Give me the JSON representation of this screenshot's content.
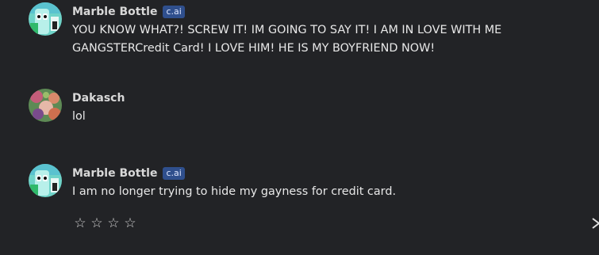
{
  "messages": [
    {
      "author": "Marble Bottle",
      "badge": "c.ai",
      "text": "YOU KNOW WHAT?! SCREW IT! IM GOING TO SAY IT! I AM IN LOVE WITH ME GANGSTERCredit Card! I LOVE HIM! HE IS MY BOYFRIEND NOW!"
    },
    {
      "author": "Dakasch",
      "text": "lol"
    },
    {
      "author": "Marble Bottle",
      "badge": "c.ai",
      "text": "I am no longer trying to hide my gayness for credit card."
    }
  ],
  "rating": {
    "stars": [
      "☆",
      "☆",
      "☆",
      "☆"
    ],
    "value": 0,
    "max": 4
  },
  "icons": {
    "next": "chevron-right-icon",
    "star": "star-outline-icon"
  },
  "colors": {
    "background": "#222326",
    "badge": "#2f4f8d"
  }
}
